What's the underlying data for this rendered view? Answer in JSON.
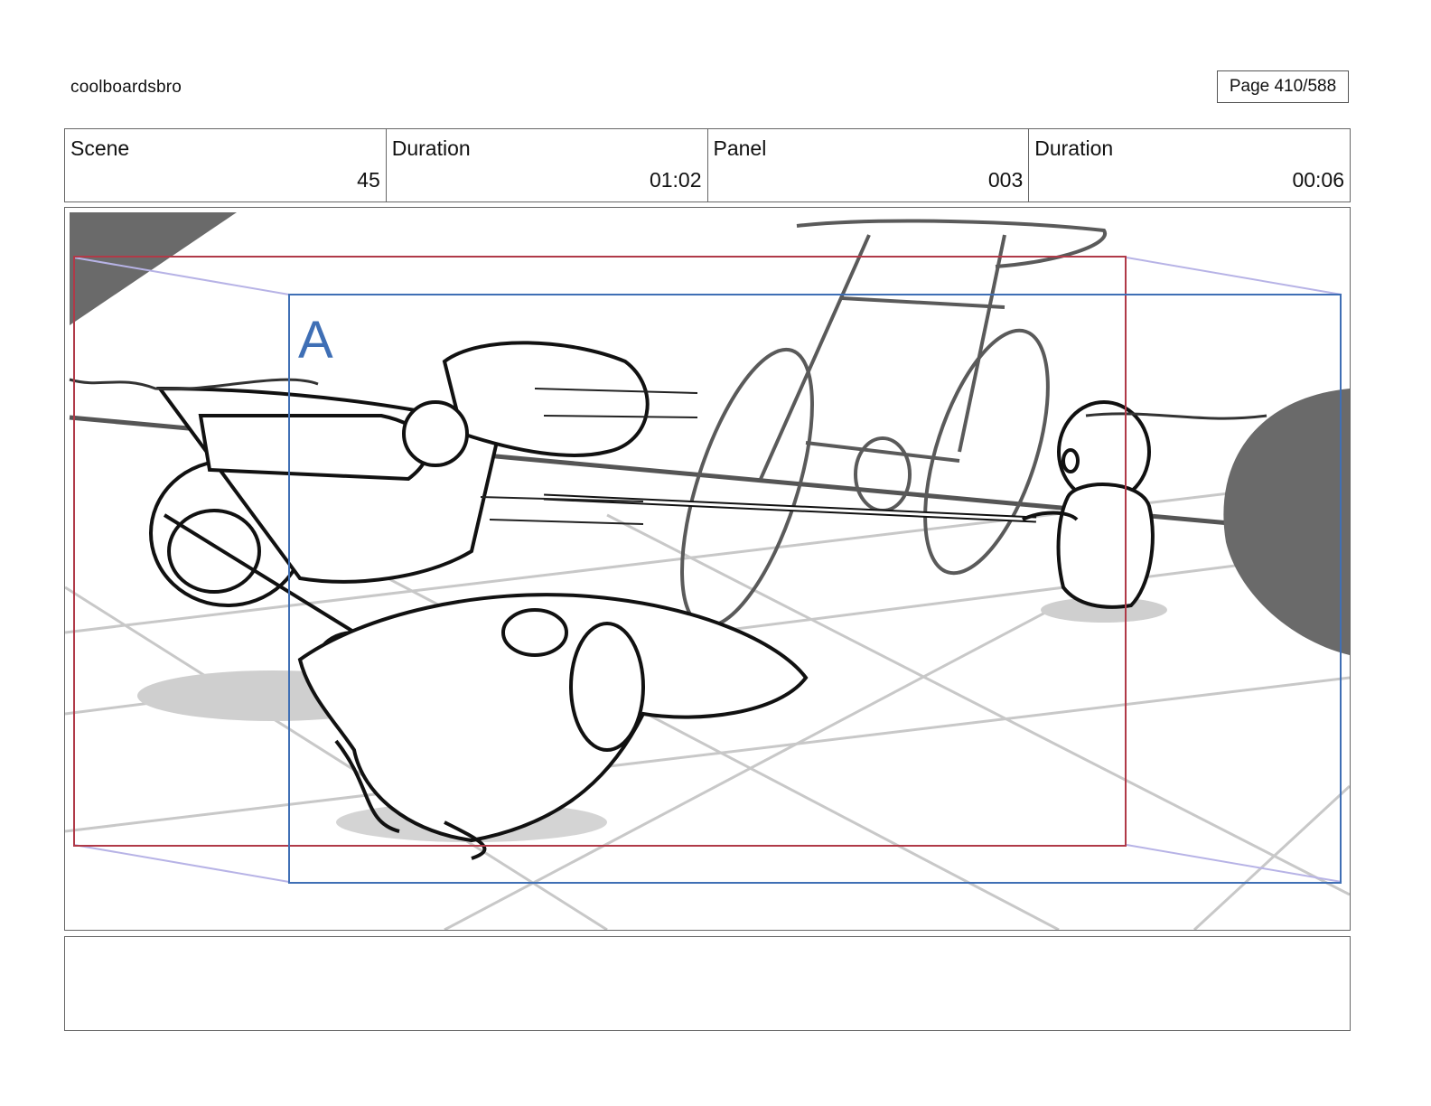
{
  "header": {
    "project_name": "coolboardsbro",
    "page_indicator": "Page 410/588"
  },
  "info_bar": [
    {
      "label": "Scene",
      "value": "45"
    },
    {
      "label": "Duration",
      "value": "01:02"
    },
    {
      "label": "Panel",
      "value": "003"
    },
    {
      "label": "Duration",
      "value": "00:06"
    }
  ],
  "panel": {
    "frame_label": "A",
    "colors": {
      "outer_frame": "#b03a48",
      "camera_frame_a": "#3f6fb5",
      "shadow": "#6a6a6a",
      "line_art": "#111111"
    }
  },
  "notes": {
    "text": ""
  }
}
